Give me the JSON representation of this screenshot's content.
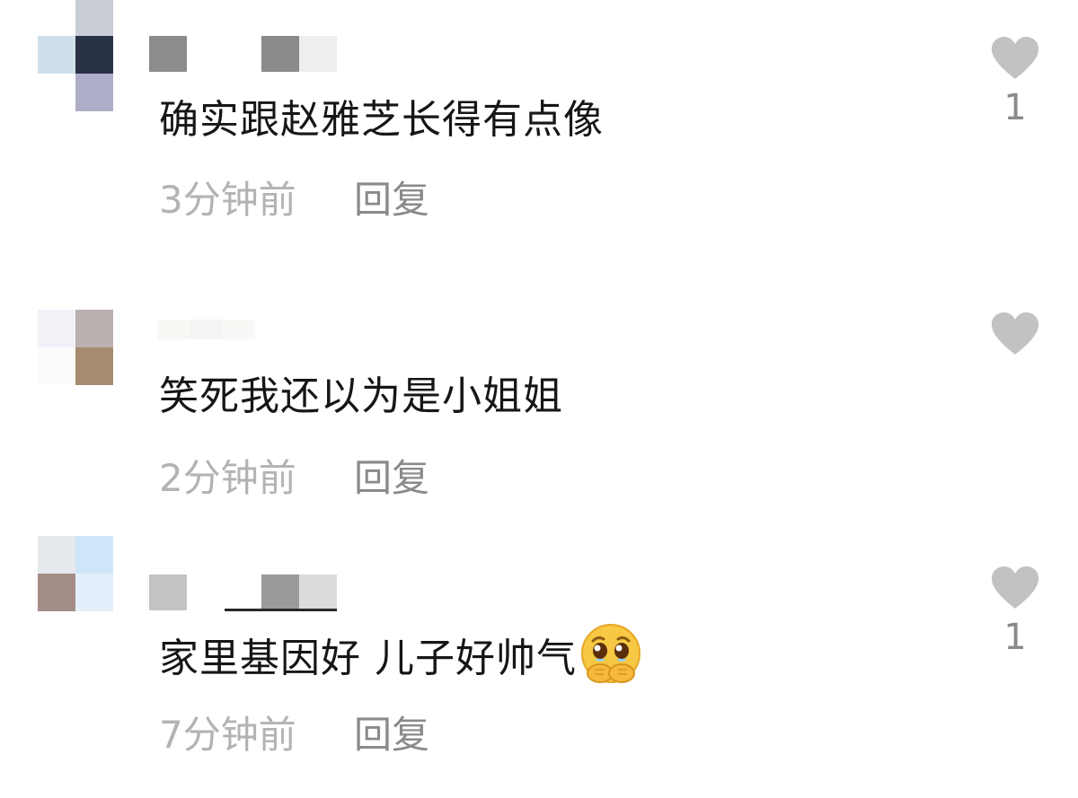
{
  "comments": [
    {
      "text": "确实跟赵雅芝长得有点像",
      "time": "3分钟前",
      "reply_label": "回复",
      "like_count": "1",
      "avatar_colors": [
        "#d0e0ea",
        "#2a3346",
        "#ffffff",
        "#aeaec8"
      ],
      "avatar_strip_color": "#c8cdd6",
      "username_blocks": [
        "#8c8c8c",
        "#8a8a8a",
        "#eeeeee"
      ]
    },
    {
      "text": "笑死我还以为是小姐姐",
      "time": "2分钟前",
      "reply_label": "回复",
      "like_count": "",
      "avatar_colors": [
        "#f3f1f8",
        "#bbb1b0",
        "#fbfbfb",
        "#a58b70"
      ],
      "avatar_strip_color": "",
      "username_blocks": [
        "#f7f7f4",
        "#f4f4f2",
        "#f8f8f6"
      ]
    },
    {
      "text": "家里基因好 儿子好帅气",
      "emoji": "crying-hands-emoji",
      "time": "7分钟前",
      "reply_label": "回复",
      "like_count": "1",
      "avatar_colors": [
        "#e6e9ee",
        "#cfe6f8",
        "#a48d86",
        "#e3f0fb"
      ],
      "avatar_strip_color": "",
      "username_blocks": [
        "#c3c3c3",
        "#9a9a9a",
        "#dcdcdc"
      ]
    }
  ],
  "colors": {
    "text": "#161616",
    "time": "#b3b3b3",
    "reply": "#8a8a8a",
    "heart": "#c2c2c2"
  }
}
